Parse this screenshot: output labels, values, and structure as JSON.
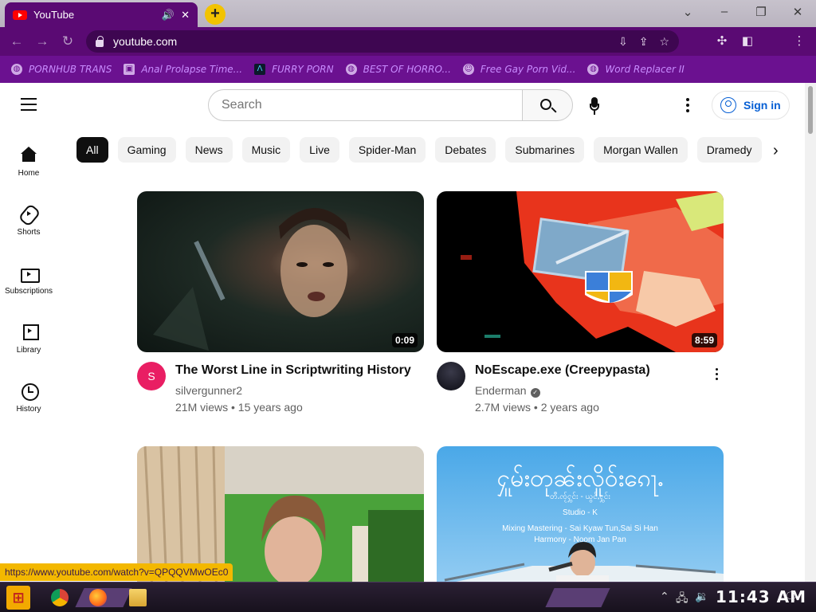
{
  "browser": {
    "tab_title": "YouTube",
    "new_tab_label": "+",
    "url": "youtube.com",
    "bookmarks": [
      {
        "label": "PORNHUB TRANS",
        "icon": "globe-icon"
      },
      {
        "label": "Anal Prolapse Time...",
        "icon": "bookmark-icon"
      },
      {
        "label": "FURRY PORN",
        "icon": "triangle-logo-icon"
      },
      {
        "label": "BEST OF HORRO...",
        "icon": "globe-icon"
      },
      {
        "label": "Free Gay Porn Vid...",
        "icon": "mascot-icon"
      },
      {
        "label": "Word Replacer II",
        "icon": "globe-icon"
      }
    ],
    "status_url": "https://www.youtube.com/watch?v=QPQQVMwOEc0"
  },
  "youtube": {
    "search_placeholder": "Search",
    "sign_in": "Sign in",
    "sidebar": [
      {
        "label": "Home",
        "icon": "home-icon"
      },
      {
        "label": "Shorts",
        "icon": "shorts-icon"
      },
      {
        "label": "Subscriptions",
        "icon": "subscriptions-icon"
      },
      {
        "label": "Library",
        "icon": "library-icon"
      },
      {
        "label": "History",
        "icon": "history-icon"
      }
    ],
    "chips": [
      "All",
      "Gaming",
      "News",
      "Music",
      "Live",
      "Spider-Man",
      "Debates",
      "Submarines",
      "Morgan Wallen",
      "Dramedy"
    ],
    "videos": [
      {
        "title": "The Worst Line in Scriptwriting History",
        "channel": "silvergunner2",
        "stats": "21M views • 15 years ago",
        "duration": "0:09",
        "avatar_letter": "S",
        "avatar_color": "#e91e63",
        "verified": false
      },
      {
        "title": "NoEscape.exe (Creepypasta)",
        "channel": "Enderman",
        "stats": "2.7M views • 2 years ago",
        "duration": "8:59",
        "avatar_letter": "",
        "avatar_color": "#1a1a2e",
        "verified": true
      },
      {
        "title": "",
        "channel": "",
        "stats": "",
        "duration": ""
      },
      {
        "title": "",
        "channel": "",
        "stats": "",
        "duration": "",
        "thumb_text": [
          "ႁူမ်းတုၼ်းလိူဝ်းၵေႃႉ",
          "တီႉၸႂ်ႁွင်း - ယွင်ႇႁွင်း",
          "Studio - K",
          "Mixing Mastering - Sai Kyaw Tun,Sai Si Han",
          "Harmony - Noom Jan Pan"
        ]
      }
    ]
  },
  "taskbar": {
    "clock": "11:43 AM"
  },
  "colors": {
    "browser_accent": "#5a0a73",
    "bookmark_bar": "#6b1190",
    "yt_red": "#ff0000",
    "link_blue": "#065fd4",
    "status_bar": "#f3b800"
  }
}
